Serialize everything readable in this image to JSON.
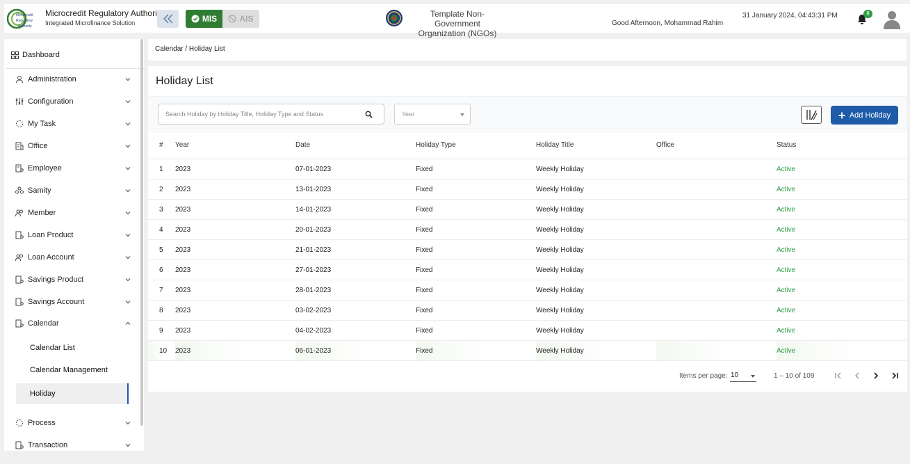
{
  "header": {
    "org_title": "Microcredit Regulatory Authority",
    "org_subtitle": "Integrated Microfinance Solution",
    "logo_text": [
      "Microcredit",
      "Regulatory",
      "Authority"
    ],
    "module_mis": "MIS",
    "module_ais": "AIS",
    "ngo_line1": "Template Non-Government",
    "ngo_line2": "Organization (NGOs)",
    "greeting": "Good Afternoon, Mohammad Rahim",
    "datetime": "31 January 2024, 04:43:31 PM",
    "notification_count": "8"
  },
  "sidebar": {
    "dashboard": "Dashboard",
    "items": [
      {
        "label": "Administration",
        "icon": "admin-icon"
      },
      {
        "label": "Configuration",
        "icon": "config-icon"
      },
      {
        "label": "My Task",
        "icon": "task-icon"
      },
      {
        "label": "Office",
        "icon": "office-icon"
      },
      {
        "label": "Employee",
        "icon": "employee-icon"
      },
      {
        "label": "Samity",
        "icon": "samity-icon"
      },
      {
        "label": "Member",
        "icon": "member-icon"
      },
      {
        "label": "Loan Product",
        "icon": "loan-product-icon"
      },
      {
        "label": "Loan Account",
        "icon": "loan-account-icon"
      },
      {
        "label": "Savings Product",
        "icon": "savings-product-icon"
      },
      {
        "label": "Savings Account",
        "icon": "savings-account-icon"
      },
      {
        "label": "Calendar",
        "icon": "calendar-icon"
      },
      {
        "label": "Process",
        "icon": "process-icon"
      },
      {
        "label": "Transaction",
        "icon": "transaction-icon"
      }
    ],
    "calendar_sub": [
      "Calendar List",
      "Calendar Management",
      "Holiday"
    ]
  },
  "breadcrumb": "Calendar / Holiday List",
  "page": {
    "title": "Holiday List",
    "search_placeholder": "Search Holiday by Holiday Title, Holiday Type and Status",
    "year_placeholder": "Year",
    "add_button": "Add Holiday"
  },
  "table": {
    "columns": [
      "#",
      "Year",
      "Date",
      "Holiday Type",
      "Holiday Title",
      "Office",
      "Status"
    ],
    "rows": [
      [
        "1",
        "2023",
        "07-01-2023",
        "Fixed",
        "Weekly Holiday",
        "",
        "Active"
      ],
      [
        "2",
        "2023",
        "13-01-2023",
        "Fixed",
        "Weekly Holiday",
        "",
        "Active"
      ],
      [
        "3",
        "2023",
        "14-01-2023",
        "Fixed",
        "Weekly Holiday",
        "",
        "Active"
      ],
      [
        "4",
        "2023",
        "20-01-2023",
        "Fixed",
        "Weekly Holiday",
        "",
        "Active"
      ],
      [
        "5",
        "2023",
        "21-01-2023",
        "Fixed",
        "Weekly Holiday",
        "",
        "Active"
      ],
      [
        "6",
        "2023",
        "27-01-2023",
        "Fixed",
        "Weekly Holiday",
        "",
        "Active"
      ],
      [
        "7",
        "2023",
        "28-01-2023",
        "Fixed",
        "Weekly Holiday",
        "",
        "Active"
      ],
      [
        "8",
        "2023",
        "03-02-2023",
        "Fixed",
        "Weekly Holiday",
        "",
        "Active"
      ],
      [
        "9",
        "2023",
        "04-02-2023",
        "Fixed",
        "Weekly Holiday",
        "",
        "Active"
      ],
      [
        "10",
        "2023",
        "06-01-2023",
        "Fixed",
        "Weekly Holiday",
        "",
        "Active"
      ]
    ]
  },
  "pagination": {
    "items_per_page_label": "Items per page:",
    "items_per_page": "10",
    "range": "1 – 10 of 109"
  },
  "colors": {
    "primary": "#1e5ba8",
    "mis_green": "#2e7d32",
    "active_status": "#2e9e44"
  }
}
